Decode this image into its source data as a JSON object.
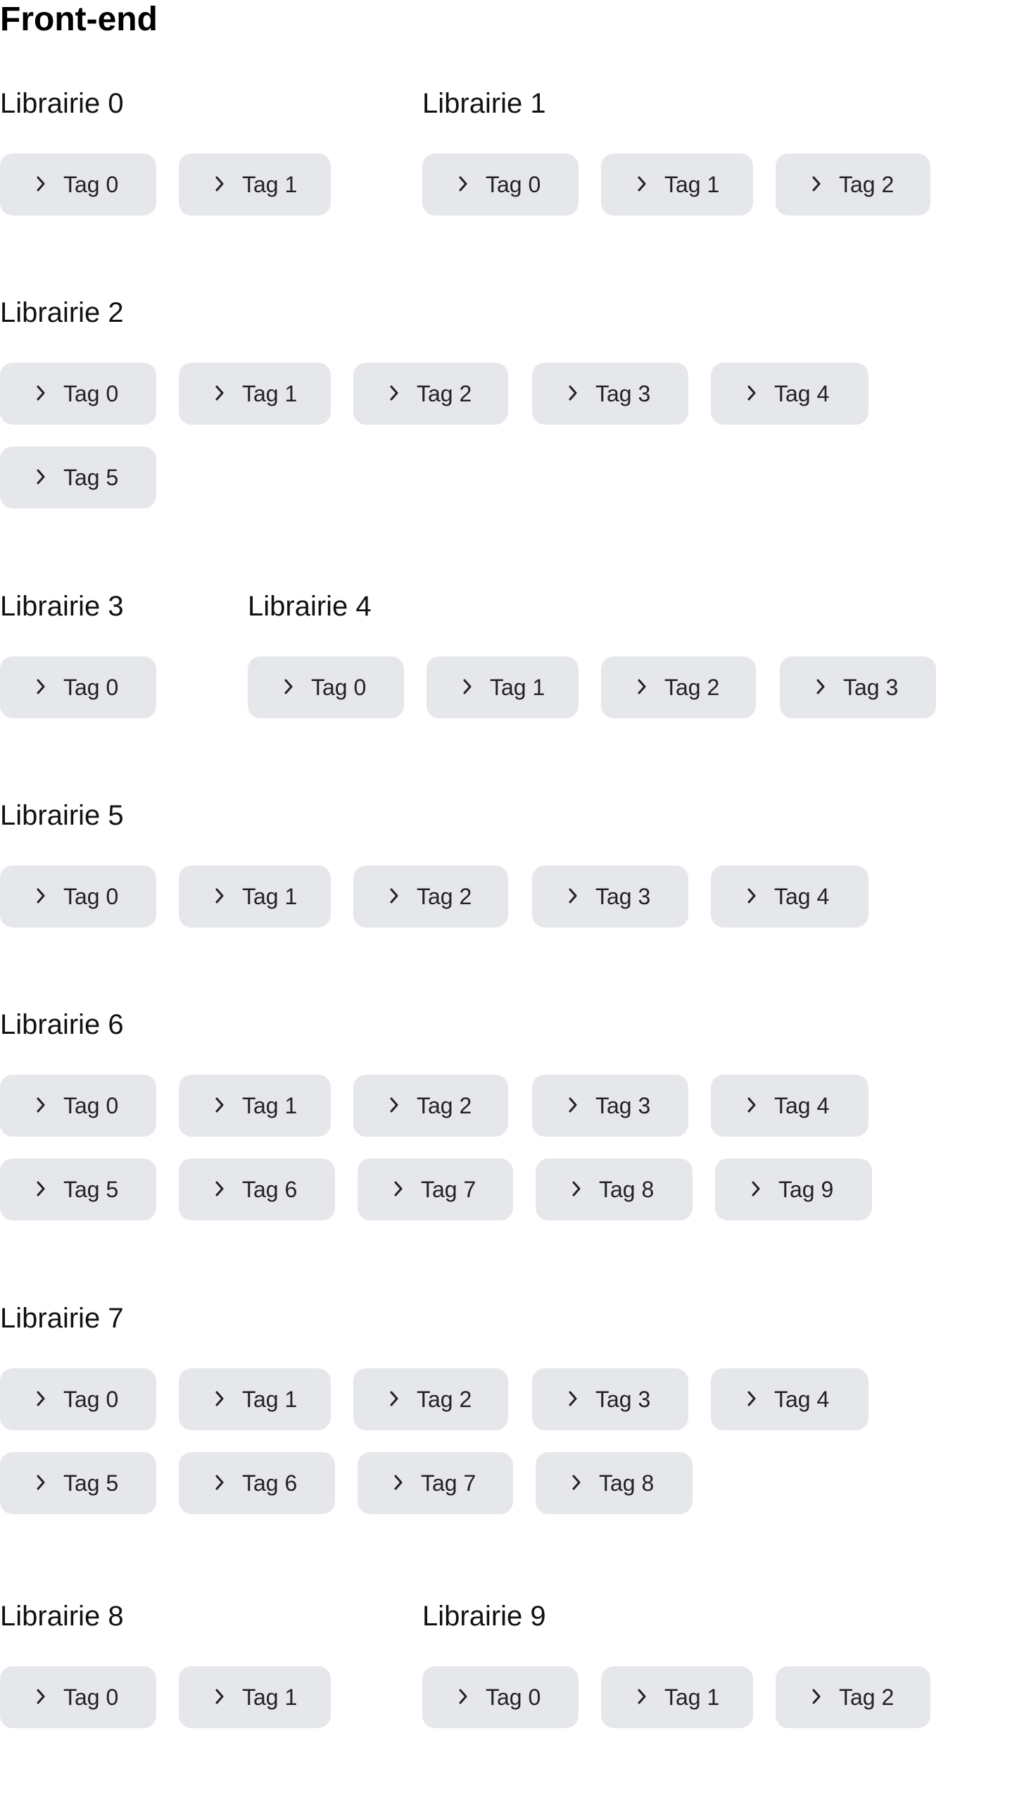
{
  "section": {
    "title": "Front-end"
  },
  "icons": {
    "tag": "chevron-right-icon"
  },
  "colors": {
    "tag_background": "#e5e7eb",
    "text": "#111111"
  },
  "libraries": [
    {
      "title": "Librairie 0",
      "tags": [
        "Tag 0",
        "Tag 1"
      ]
    },
    {
      "title": "Librairie 1",
      "tags": [
        "Tag 0",
        "Tag 1",
        "Tag 2"
      ]
    },
    {
      "title": "Librairie 2",
      "tags": [
        "Tag 0",
        "Tag 1",
        "Tag 2",
        "Tag 3",
        "Tag 4",
        "Tag 5"
      ]
    },
    {
      "title": "Librairie 3",
      "tags": [
        "Tag 0"
      ]
    },
    {
      "title": "Librairie 4",
      "tags": [
        "Tag 0",
        "Tag 1",
        "Tag 2",
        "Tag 3"
      ]
    },
    {
      "title": "Librairie 5",
      "tags": [
        "Tag 0",
        "Tag 1",
        "Tag 2",
        "Tag 3",
        "Tag 4"
      ]
    },
    {
      "title": "Librairie 6",
      "tags": [
        "Tag 0",
        "Tag 1",
        "Tag 2",
        "Tag 3",
        "Tag 4",
        "Tag 5",
        "Tag 6",
        "Tag 7",
        "Tag 8",
        "Tag 9"
      ]
    },
    {
      "title": "Librairie 7",
      "tags": [
        "Tag 0",
        "Tag 1",
        "Tag 2",
        "Tag 3",
        "Tag 4",
        "Tag 5",
        "Tag 6",
        "Tag 7",
        "Tag 8"
      ]
    },
    {
      "title": "Librairie 8",
      "tags": [
        "Tag 0",
        "Tag 1"
      ]
    },
    {
      "title": "Librairie 9",
      "tags": [
        "Tag 0",
        "Tag 1",
        "Tag 2"
      ]
    }
  ]
}
